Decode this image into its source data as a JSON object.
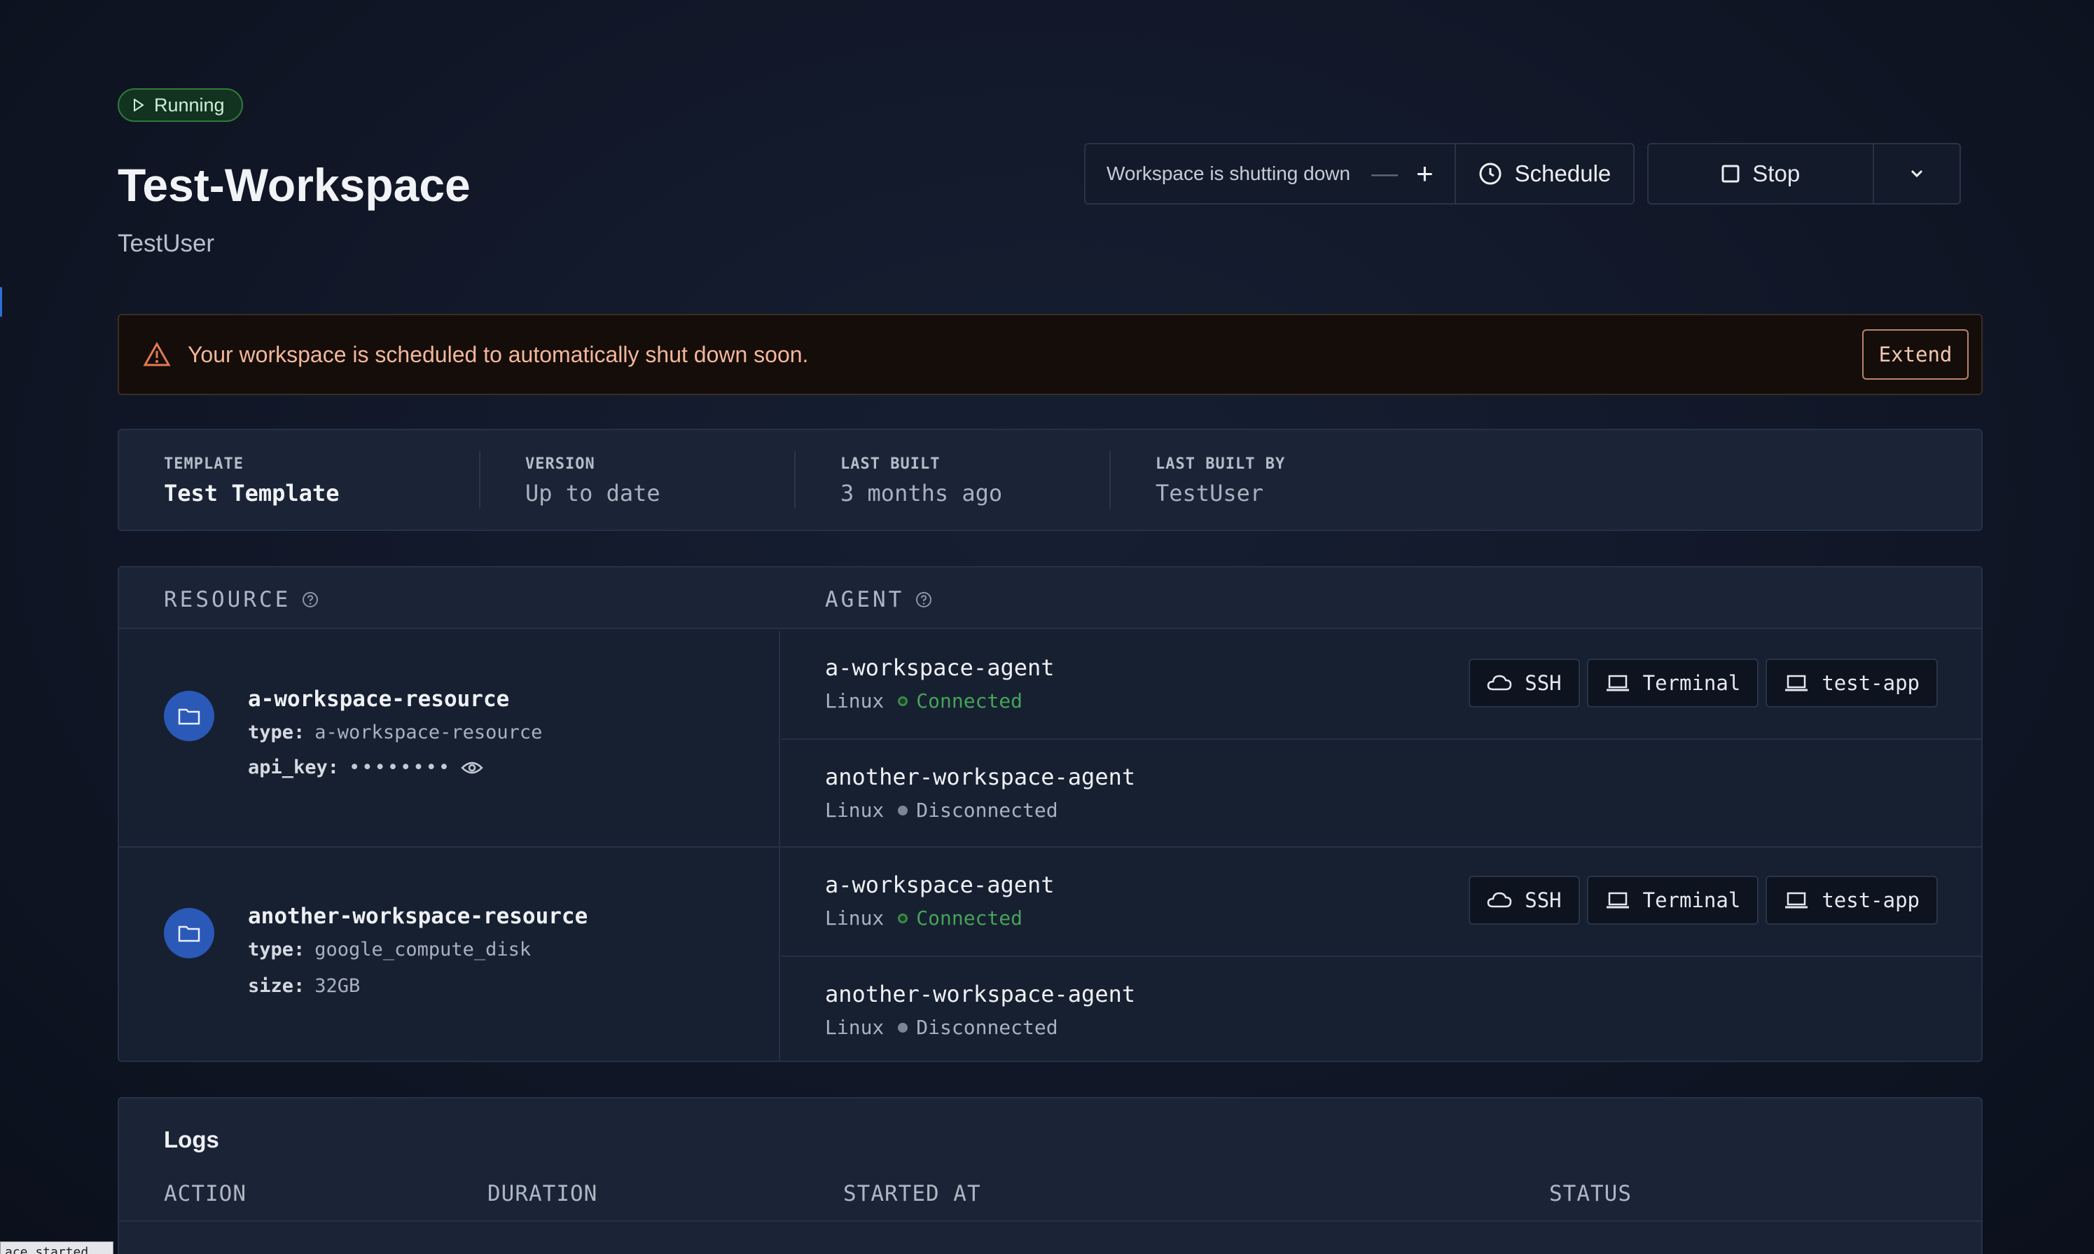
{
  "workspace": {
    "status": "Running",
    "title": "Test-Workspace",
    "owner": "TestUser"
  },
  "actions": {
    "deadline_text": "Workspace is shutting down",
    "decrease_label": "—",
    "increase_label": "+",
    "schedule_label": "Schedule",
    "stop_label": "Stop"
  },
  "alert": {
    "message": "Your workspace is scheduled to automatically shut down soon.",
    "extend_label": "Extend"
  },
  "stats": [
    {
      "label": "TEMPLATE",
      "value": "Test Template"
    },
    {
      "label": "VERSION",
      "value": "Up to date"
    },
    {
      "label": "LAST BUILT",
      "value": "3 months ago"
    },
    {
      "label": "LAST BUILT BY",
      "value": "TestUser"
    }
  ],
  "resources_table": {
    "resource_header": "RESOURCE",
    "agent_header": "AGENT",
    "rows": [
      {
        "name": "a-workspace-resource",
        "meta": [
          {
            "key": "type:",
            "value": "a-workspace-resource"
          },
          {
            "key": "api_key:",
            "value": "••••••••"
          }
        ],
        "agents": [
          {
            "name": "a-workspace-agent",
            "os": "Linux",
            "state": "Connected",
            "apps": [
              "SSH",
              "Terminal",
              "test-app"
            ]
          },
          {
            "name": "another-workspace-agent",
            "os": "Linux",
            "state": "Disconnected",
            "apps": []
          }
        ]
      },
      {
        "name": "another-workspace-resource",
        "meta": [
          {
            "key": "type:",
            "value": "google_compute_disk"
          },
          {
            "key": "size:",
            "value": "32GB"
          }
        ],
        "agents": [
          {
            "name": "a-workspace-agent",
            "os": "Linux",
            "state": "Connected",
            "apps": [
              "SSH",
              "Terminal",
              "test-app"
            ]
          },
          {
            "name": "another-workspace-agent",
            "os": "Linux",
            "state": "Disconnected",
            "apps": []
          }
        ]
      }
    ]
  },
  "logs": {
    "title": "Logs",
    "columns": [
      "ACTION",
      "DURATION",
      "STARTED AT",
      "STATUS"
    ]
  },
  "tooltip_text": "ace  started",
  "colors": {
    "accent_blue": "#2a59b8",
    "running_green": "#2f7a3a",
    "connected_green": "#45a35a",
    "warning_orange": "#f2b79a"
  }
}
